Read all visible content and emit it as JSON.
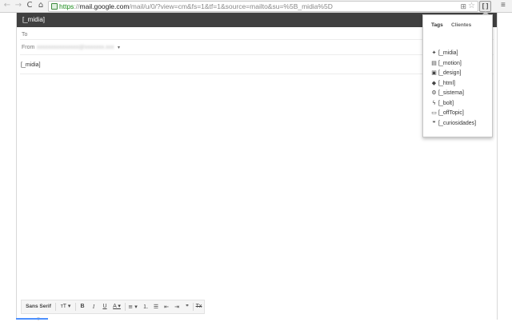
{
  "browser": {
    "url_scheme": "https",
    "url_sep": "://",
    "url_host": "mail.google.com",
    "url_path": "/mail/u/0/?view=cm&fs=1&tf=1&source=mailto&su=%5B_midia%5D",
    "nav_icons": {
      "back": "back-arrow-icon",
      "forward": "forward-arrow-icon",
      "reload": "reload-icon",
      "home": "home-icon"
    },
    "back_glyph": "←",
    "forward_glyph": "→",
    "reload_glyph": "C",
    "home_glyph": "⌂",
    "bookmark_glyph": "⊞",
    "star_glyph": "☆",
    "extension_glyph": "[ ]",
    "menu_glyph": "≡"
  },
  "compose": {
    "title": "[_midia]",
    "to_label": "To",
    "from_label": "From",
    "from_value": "xxxxxxxxxxxxxxx@xxxxxxx.xxx",
    "from_dropdown_glyph": "▾",
    "subject": "[_midia]"
  },
  "toolbar": {
    "font": "Sans Serif ▾",
    "size": "тT ▾",
    "bold": "B",
    "italic": "I",
    "underline": "U",
    "text_color": "A ▾",
    "align": "≡ ▾",
    "numbered_list": "⒈",
    "bulleted_list": "☰",
    "indent_less": "⇤",
    "indent_more": "⇥",
    "quote": "❞",
    "remove_format": "Tx"
  },
  "popup": {
    "tabs": [
      "Tags",
      "Clientes"
    ],
    "items": [
      {
        "icon": "twitter-bird-icon",
        "glyph": "✦",
        "label": "[_midia]"
      },
      {
        "icon": "film-icon",
        "glyph": "▤",
        "label": "[_motion]"
      },
      {
        "icon": "image-icon",
        "glyph": "▣",
        "label": "[_design]"
      },
      {
        "icon": "tags-icon",
        "glyph": "◆",
        "label": "[_html]"
      },
      {
        "icon": "cogs-icon",
        "glyph": "⚙",
        "label": "[_sistema]"
      },
      {
        "icon": "bolt-icon",
        "glyph": "ϟ",
        "label": "[_bolt]"
      },
      {
        "icon": "laptop-icon",
        "glyph": "▭",
        "label": "[_offTopic]"
      },
      {
        "icon": "comments-icon",
        "glyph": "❝",
        "label": "[_curiosidades]"
      }
    ]
  },
  "colors": {
    "compose_header": "#404040",
    "accent_blue": "#4d90fe",
    "url_secure_green": "#1a8a1a"
  }
}
